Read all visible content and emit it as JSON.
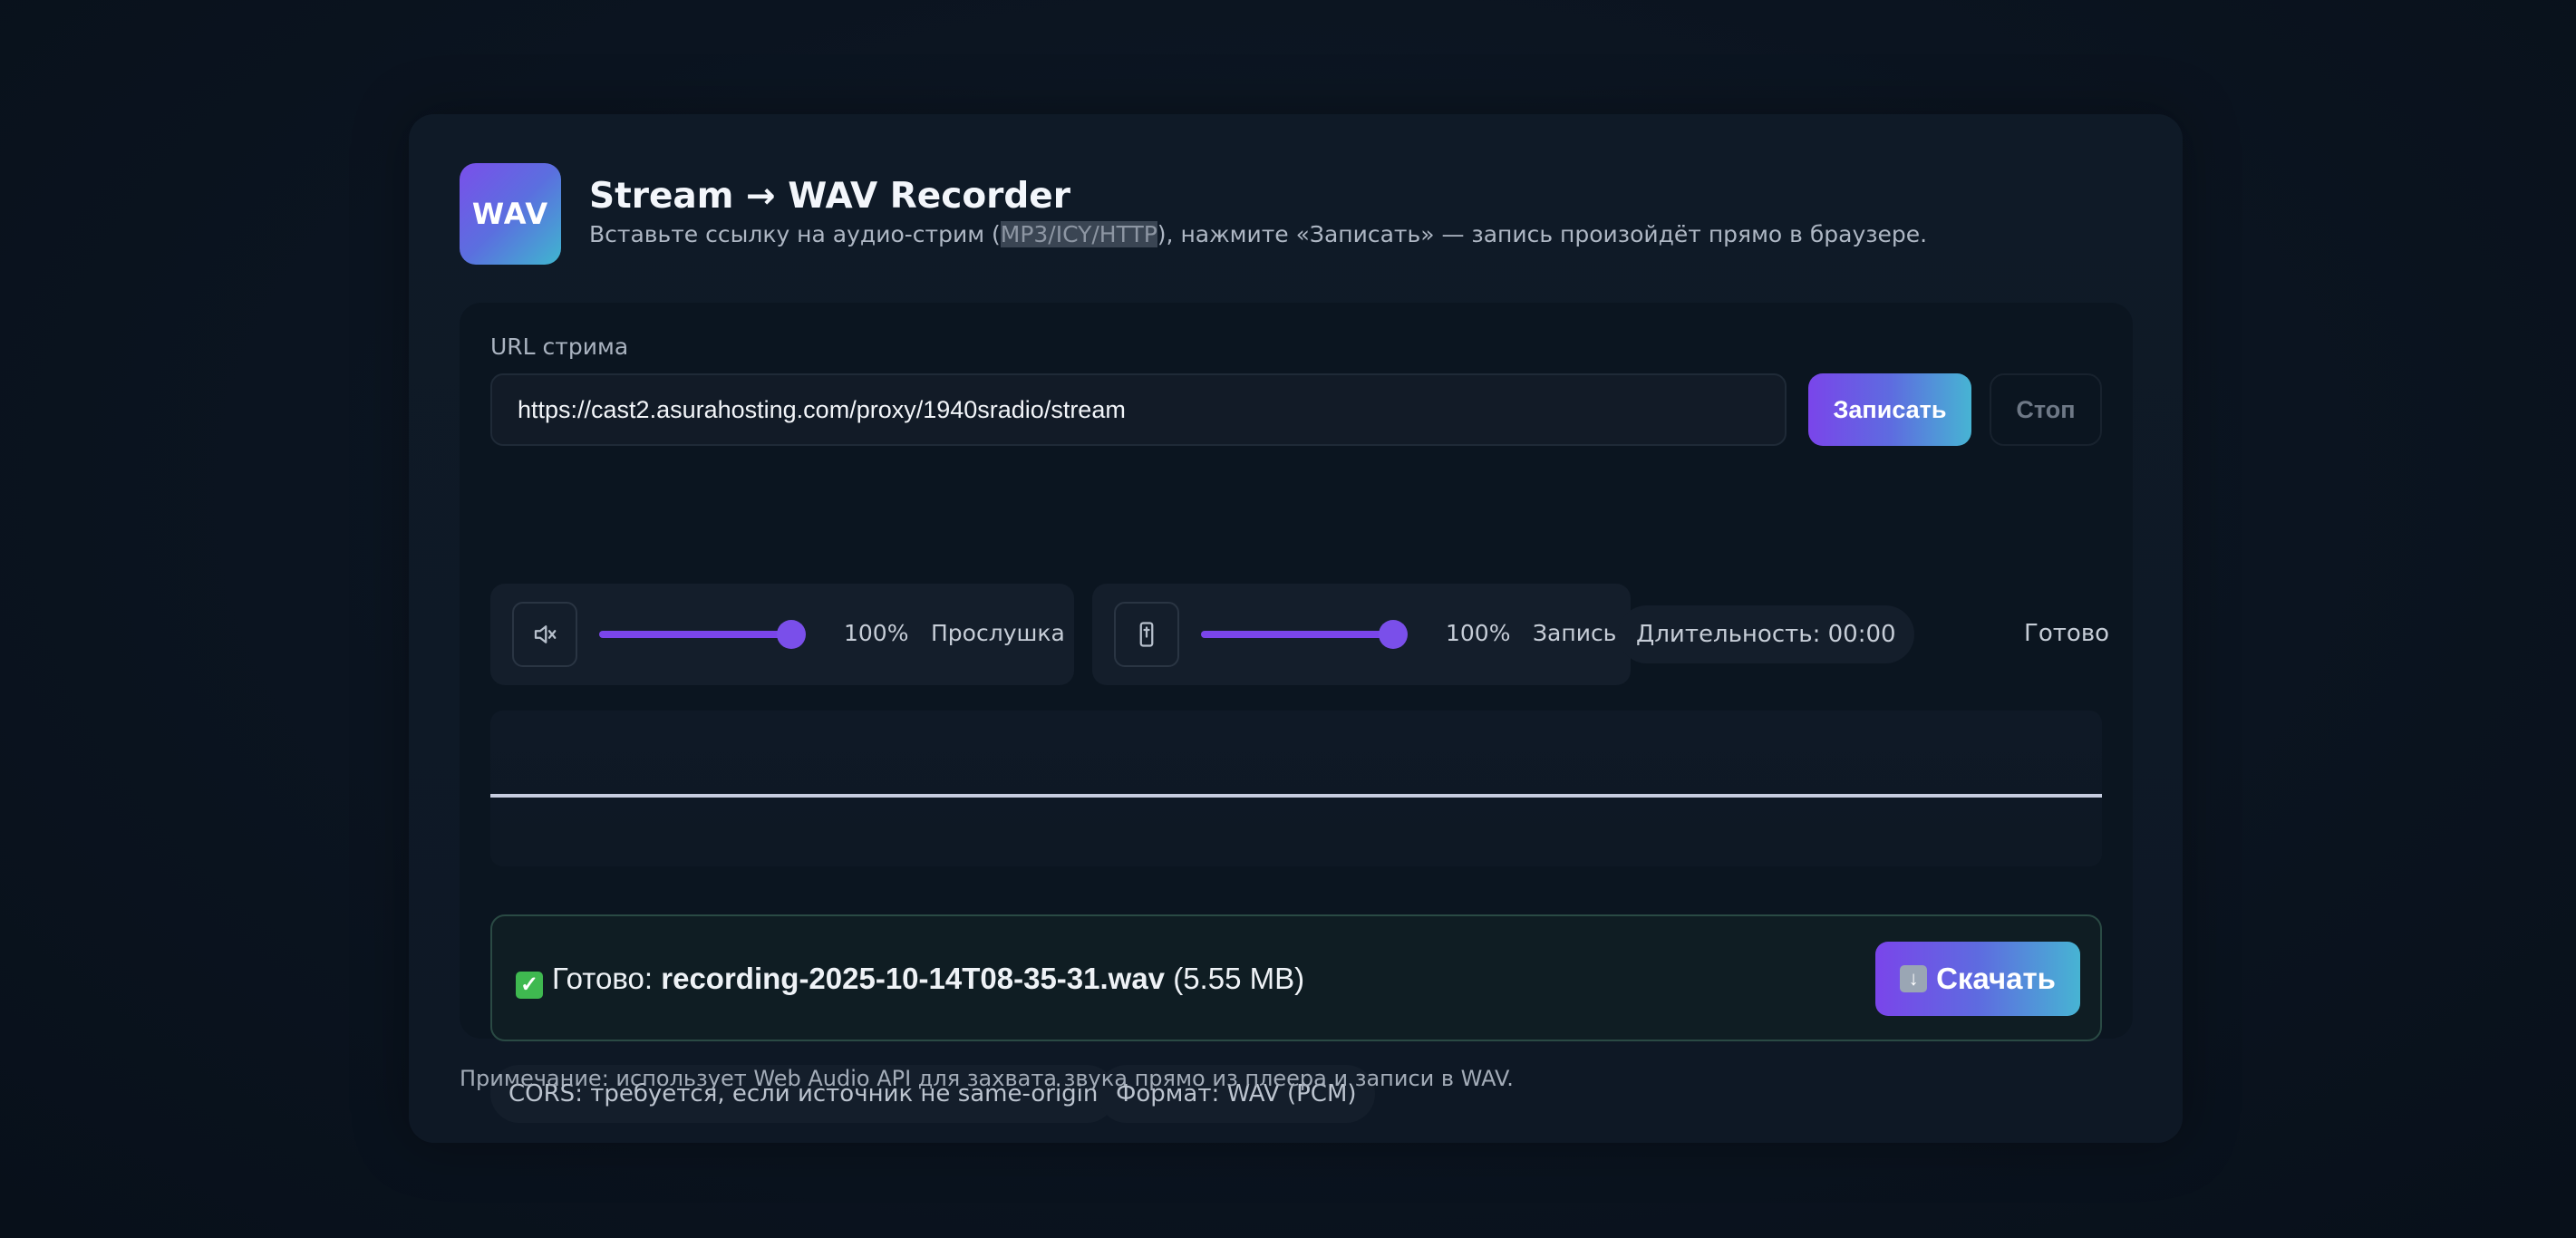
{
  "header": {
    "logo_text": "WAV",
    "title": "Stream → WAV Recorder",
    "subtitle_before": "Вставьте ссылку на аудио-стрим (",
    "subtitle_highlight": "MP3/ICY/HTTP",
    "subtitle_after": "), нажмите «Записать» — запись произойдёт прямо в браузере."
  },
  "form": {
    "url_label": "URL стрима",
    "url_value": "https://cast2.asurahosting.com/proxy/1940sradio/stream",
    "record_label": "Записать",
    "stop_label": "Стоп"
  },
  "monitor": {
    "icon": "speaker-muted-icon",
    "volume": 1.0,
    "percent_text": "100%",
    "label": "Прослушка"
  },
  "recording": {
    "icon": "microphone-icon",
    "volume": 1.0,
    "percent_text": "100%",
    "label": "Запись"
  },
  "status": {
    "duration_text": "Длительность: 00:00",
    "state": "Готово"
  },
  "result": {
    "prefix": "Готово:",
    "filename": "recording-2025-10-14T08-35-31.wav",
    "size": "(5.55 MB)",
    "download_label": "Скачать"
  },
  "chips": {
    "cors": "CORS: требуется, если источник не same-origin",
    "format": "Формат: WAV (PCM)"
  },
  "footer": {
    "note": "Примечание: использует Web Audio API для захвата звука прямо из плеера и записи в WAV."
  },
  "colors": {
    "accent_start": "#7a45ea",
    "accent_end": "#47b4d3",
    "background": "#0b1420",
    "success_border": "#2a4a44"
  }
}
